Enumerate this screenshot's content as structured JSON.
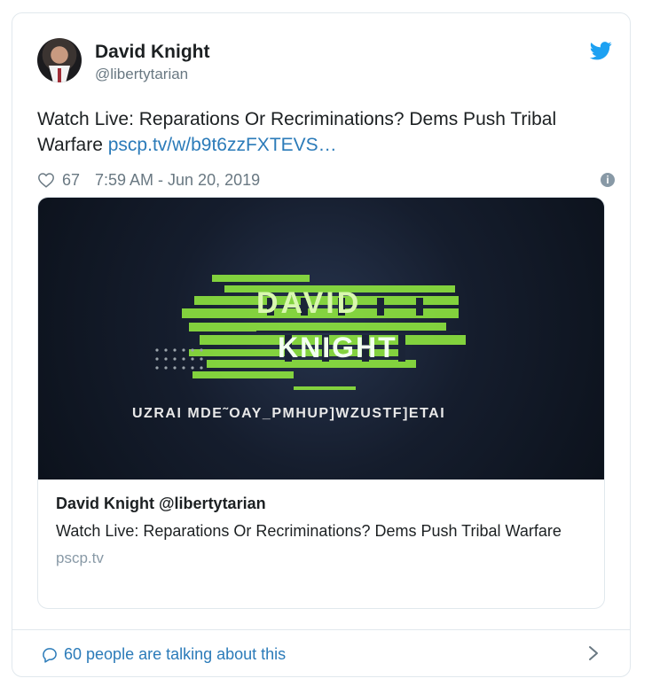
{
  "tweet": {
    "author": {
      "name": "David Knight",
      "handle": "@libertytarian"
    },
    "text": "Watch Live: Reparations Or Recriminations? Dems Push Tribal Warfare",
    "link_text": "pscp.tv/w/b9t6zzFXTEVS…",
    "likes": "67",
    "timestamp": "7:59 AM - Jun 20, 2019",
    "info_glyph": "i"
  },
  "media": {
    "graphic_line1": "DAVID",
    "graphic_line2": "KNIGHT",
    "subtitle": "UZRAI MDE˜OAY_PMHUP]WZUSTF]ETAI",
    "title": "David Knight @libertytarian",
    "description": "Watch Live: Reparations Or Recriminations? Dems Push Tribal Warfare",
    "domain": "pscp.tv"
  },
  "footer": {
    "talking": "60 people are talking about this"
  },
  "colors": {
    "link": "#2b7bb9",
    "muted": "#697882",
    "border": "#e1e8ed",
    "twitter": "#1da1f2",
    "graphic_green": "#8ee53f"
  },
  "icons": {
    "brand": "twitter-bird-icon",
    "like": "heart-icon",
    "info": "info-icon",
    "comment": "comment-icon",
    "more": "chevron-right-icon"
  }
}
